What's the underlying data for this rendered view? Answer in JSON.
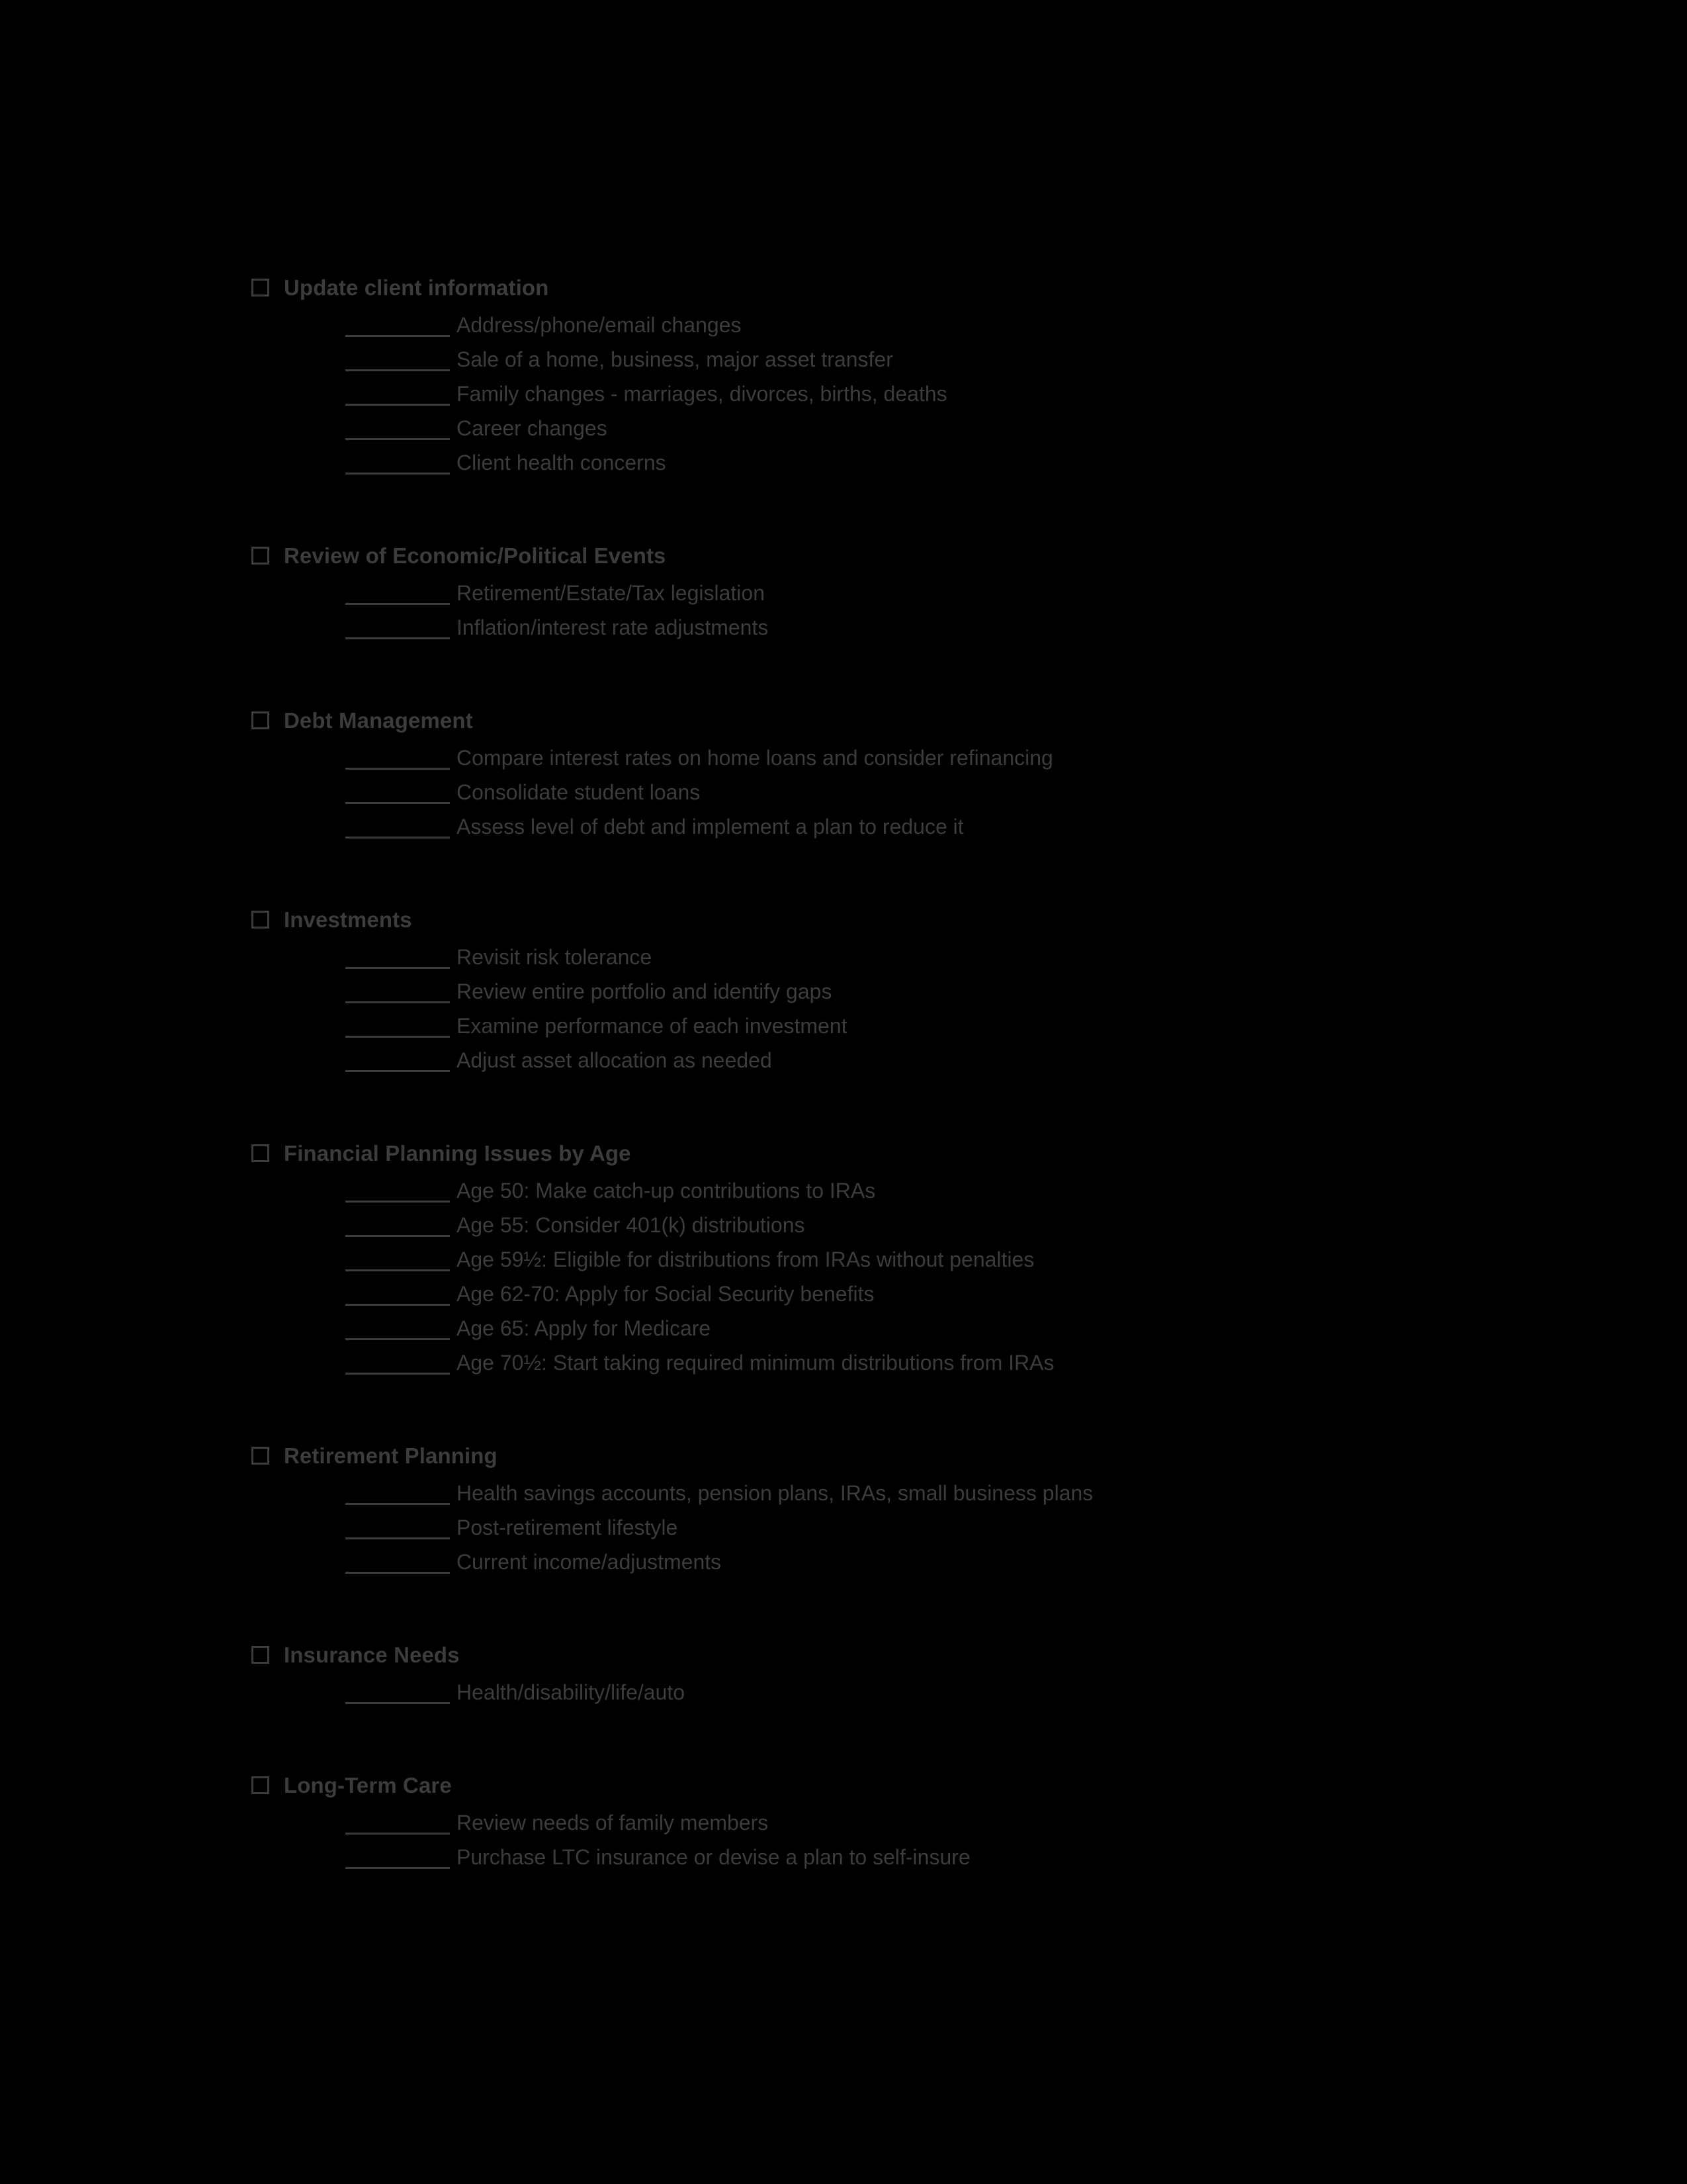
{
  "document": {
    "background_color": "#000000",
    "text_color": "#3c3c3c",
    "checkbox_glyph": "open-square",
    "sections": [
      {
        "title": "Update client information",
        "items": [
          "Address/phone/email changes",
          "Sale of a home, business, major asset transfer",
          "Family changes - marriages, divorces, births, deaths",
          "Career changes",
          "Client health concerns"
        ]
      },
      {
        "title": "Review of Economic/Political Events",
        "items": [
          "Retirement/Estate/Tax legislation",
          "Inflation/interest rate adjustments"
        ]
      },
      {
        "title": "Debt Management",
        "items": [
          "Compare interest rates on home loans and consider refinancing",
          "Consolidate student loans",
          "Assess level of debt and implement a plan to reduce it"
        ]
      },
      {
        "title": "Investments",
        "items": [
          "Revisit risk tolerance",
          "Review entire portfolio and identify gaps",
          "Examine performance of each investment",
          "Adjust asset allocation as needed"
        ]
      },
      {
        "title": "Financial Planning Issues by Age",
        "items": [
          "Age 50: Make catch-up contributions to IRAs",
          "Age 55: Consider 401(k) distributions",
          "Age 59½: Eligible for distributions from IRAs without penalties",
          "Age 62-70: Apply for Social Security benefits",
          "Age 65: Apply for Medicare",
          "Age 70½: Start taking required minimum distributions from IRAs"
        ]
      },
      {
        "title": "Retirement Planning",
        "items": [
          "Health savings accounts, pension plans, IRAs, small business plans",
          "Post-retirement lifestyle",
          "Current income/adjustments"
        ]
      },
      {
        "title": "Insurance Needs",
        "items": [
          "Health/disability/life/auto"
        ]
      },
      {
        "title": "Long-Term Care",
        "items": [
          "Review needs of family members",
          "Purchase LTC insurance or devise a plan to self-insure"
        ]
      }
    ]
  }
}
